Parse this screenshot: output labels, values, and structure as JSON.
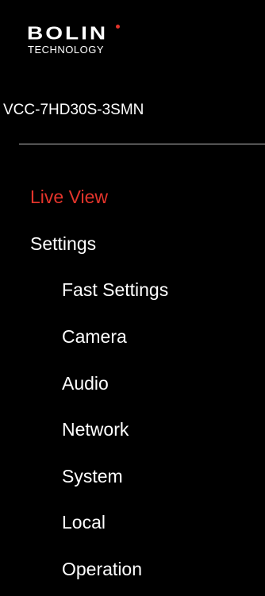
{
  "brand": {
    "name": "BOLIN",
    "tagline": "TECHNOLOGY",
    "accent_color": "#e3342b"
  },
  "device": {
    "model": "VCC-7HD30S-3SMN"
  },
  "nav": {
    "live_view": "Live View",
    "settings": "Settings",
    "items": [
      {
        "label": "Fast Settings"
      },
      {
        "label": "Camera"
      },
      {
        "label": "Audio"
      },
      {
        "label": "Network"
      },
      {
        "label": "System"
      },
      {
        "label": "Local"
      },
      {
        "label": "Operation"
      }
    ]
  }
}
